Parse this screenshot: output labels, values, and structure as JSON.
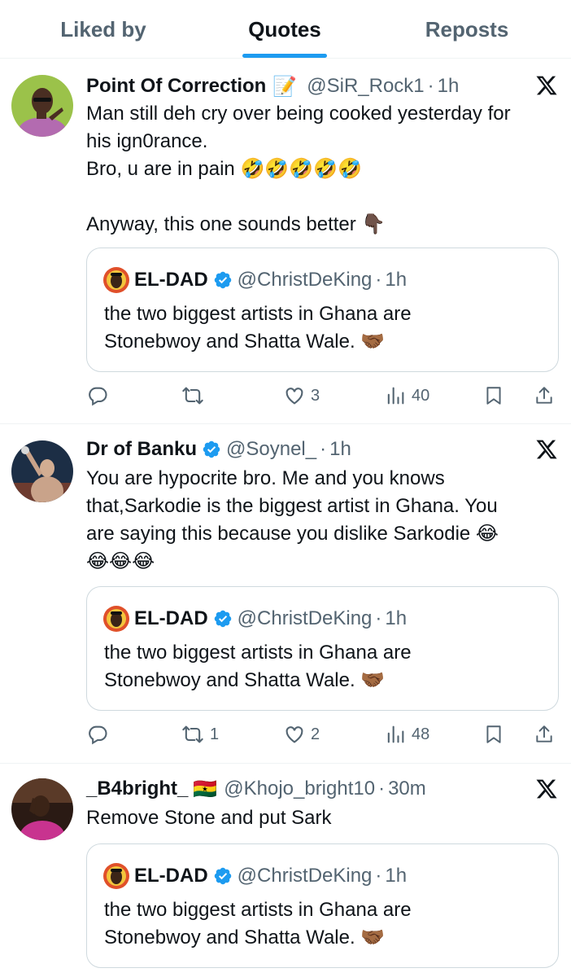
{
  "tabs": [
    {
      "label": "Liked by"
    },
    {
      "label": "Quotes"
    },
    {
      "label": "Reposts"
    }
  ],
  "quoted": {
    "name": "EL-DAD",
    "handle": "@ChristDeKing",
    "dot": "·",
    "time": "1h",
    "lines": [
      "the two biggest artists in Ghana are",
      "Stonebwoy and Shatta Wale. 🤝🏾"
    ]
  },
  "posts": [
    {
      "name": "Point Of Correction",
      "name_emoji": "📝",
      "handle": "@SiR_Rock1",
      "dot": "·",
      "time": "1h",
      "lines": [
        "Man still deh cry over being cooked yesterday for",
        "his ign0rance.",
        "Bro, u are in pain 🤣🤣🤣🤣🤣",
        "",
        "Anyway, this one sounds better 👇🏿"
      ],
      "stats": {
        "replies": "",
        "reposts": "",
        "likes": "3",
        "views": "40"
      }
    },
    {
      "name": "Dr of Banku",
      "handle": "@Soynel_",
      "dot": "·",
      "time": "1h",
      "lines": [
        "You are hypocrite bro. Me and you knows",
        "that,Sarkodie is the biggest artist in Ghana. You",
        "are saying this because you dislike Sarkodie 😂",
        "😂😂😂"
      ],
      "stats": {
        "replies": "",
        "reposts": "1",
        "likes": "2",
        "views": "48"
      }
    },
    {
      "name": "_B4bright_",
      "name_emoji": "🇬🇭",
      "handle": "@Khojo_bright10",
      "dot": "·",
      "time": "30m",
      "lines": [
        "Remove Stone and put Sark"
      ]
    }
  ],
  "colors": {
    "accent": "#1d9bf0",
    "muted": "#536471",
    "text": "#0f1419",
    "border": "#cfd9de"
  },
  "icons": [
    "x-logo-icon",
    "verified-badge-icon",
    "reply-icon",
    "repost-icon",
    "like-icon",
    "views-icon",
    "bookmark-icon",
    "share-icon"
  ]
}
